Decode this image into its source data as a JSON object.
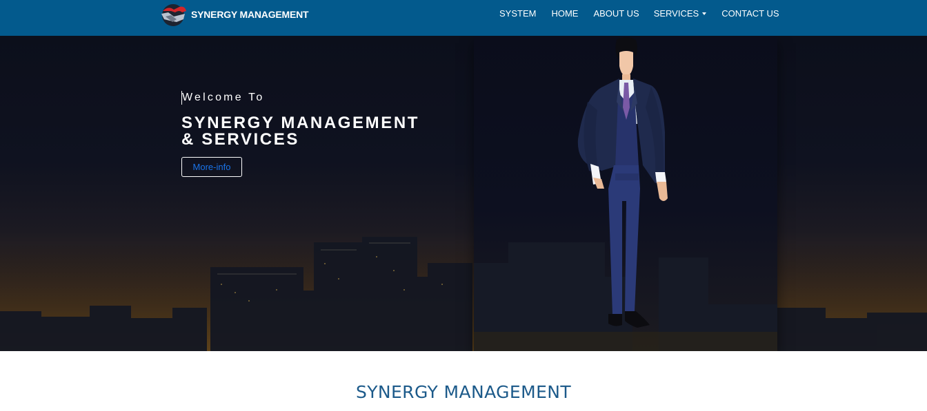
{
  "brand": {
    "name": "SYNERGY MANAGEMENT",
    "logo_icon": "handshake-logo-icon"
  },
  "nav": {
    "items": [
      {
        "label": "SYSTEM"
      },
      {
        "label": "HOME"
      },
      {
        "label": "ABOUT US"
      },
      {
        "label": "SERVICES",
        "has_dropdown": true
      },
      {
        "label": "CONTACT US"
      }
    ]
  },
  "hero": {
    "welcome": "Welcome To",
    "title_line1": "SYNERGY MANAGEMENT",
    "title_line2": "& SERVICES",
    "button_label": "More-info",
    "illustration": "businessman-illustration"
  },
  "section": {
    "title": "SYNERGY MANAGEMENT"
  },
  "colors": {
    "navbar": "#035a8d",
    "section_title": "#1c5a8a",
    "button_text": "#1a73e8"
  }
}
